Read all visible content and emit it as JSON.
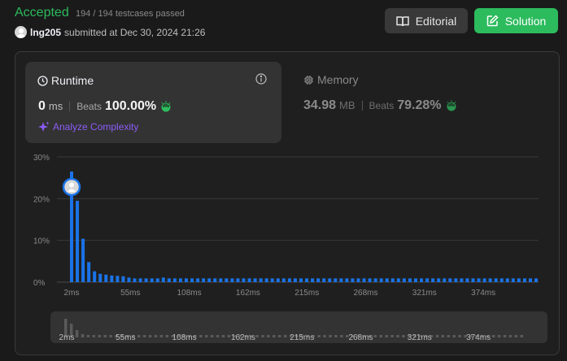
{
  "header": {
    "status": "Accepted",
    "testcases": "194 / 194 testcases passed",
    "user": "lng205",
    "submitted": "submitted at Dec 30, 2024 21:26",
    "avatar_icon": "user-avatar-icon"
  },
  "buttons": {
    "editorial": "Editorial",
    "editorial_icon": "book-open-icon",
    "solution": "Solution",
    "solution_icon": "edit-icon"
  },
  "runtime": {
    "title": "Runtime",
    "title_icon": "clock-icon",
    "info_icon": "info-icon",
    "value": "0",
    "unit": "ms",
    "beats_label": "Beats",
    "beats_value": "100.00%",
    "beats_icon": "clap-icon",
    "analyze": "Analyze Complexity",
    "analyze_icon": "sparkles-icon"
  },
  "memory": {
    "title": "Memory",
    "title_icon": "chip-icon",
    "value": "34.98",
    "unit": "MB",
    "beats_label": "Beats",
    "beats_value": "79.28%",
    "beats_icon": "clap-icon"
  },
  "colors": {
    "accepted": "#2cbb5d",
    "bar": "#1a73e8",
    "analyze": "#8b5cf6"
  },
  "chart_data": {
    "type": "bar",
    "ylabels": [
      "30%",
      "20%",
      "10%",
      "0%"
    ],
    "yticks": [
      30,
      20,
      10,
      0
    ],
    "ylim": [
      0,
      30
    ],
    "xtick_labels": [
      "2ms",
      "55ms",
      "108ms",
      "162ms",
      "215ms",
      "268ms",
      "321ms",
      "374ms"
    ],
    "grid": true,
    "highlight_index": 0,
    "values": [
      26.5,
      19.5,
      10.4,
      4.8,
      2.6,
      2.0,
      1.8,
      1.6,
      1.5,
      1.4,
      1.1,
      0.9,
      0.9,
      0.9,
      0.9,
      0.9,
      1.1,
      0.9,
      0.9,
      0.9,
      0.9,
      0.9,
      0.9,
      0.9,
      0.9,
      0.9,
      0.9,
      0.9,
      0.9,
      0.9,
      0.9,
      0.9,
      0.9,
      0.9,
      0.9,
      0.9,
      0.9,
      0.9,
      0.9,
      0.9,
      0.9,
      0.9,
      0.9,
      0.9,
      0.9,
      0.9,
      0.9,
      0.9,
      0.9,
      0.9,
      0.9,
      0.9,
      0.9,
      0.9,
      0.9,
      0.9,
      0.9,
      0.9,
      0.9,
      0.9,
      0.9,
      0.9,
      0.9,
      0.9,
      0.9,
      0.9,
      0.9,
      0.9,
      0.9,
      0.9,
      0.9,
      0.9,
      0.9,
      0.9,
      0.9,
      0.9,
      0.9,
      0.9,
      0.9,
      0.9,
      0.9,
      0.9
    ]
  }
}
